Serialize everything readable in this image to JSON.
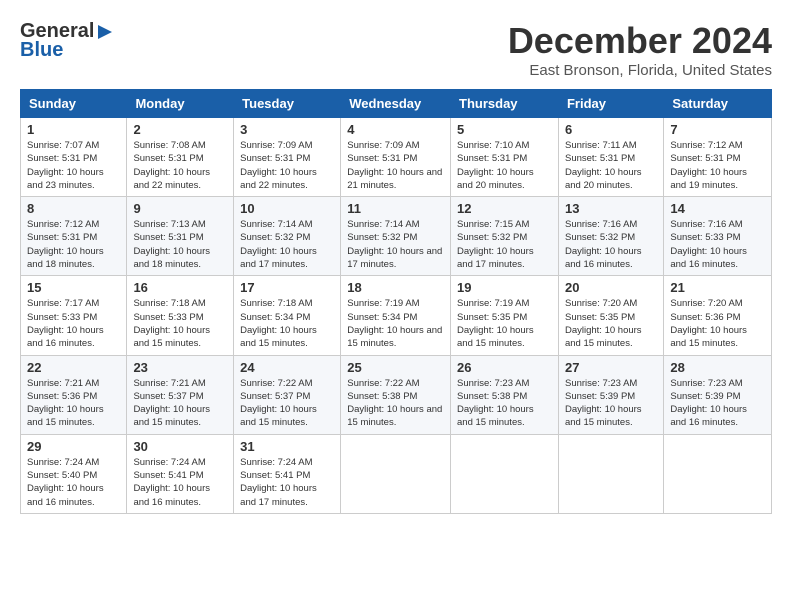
{
  "header": {
    "logo_line1": "General",
    "logo_line2": "Blue",
    "month": "December 2024",
    "location": "East Bronson, Florida, United States"
  },
  "days_of_week": [
    "Sunday",
    "Monday",
    "Tuesday",
    "Wednesday",
    "Thursday",
    "Friday",
    "Saturday"
  ],
  "weeks": [
    [
      {
        "day": "1",
        "sunrise": "7:07 AM",
        "sunset": "5:31 PM",
        "daylight": "10 hours and 23 minutes."
      },
      {
        "day": "2",
        "sunrise": "7:08 AM",
        "sunset": "5:31 PM",
        "daylight": "10 hours and 22 minutes."
      },
      {
        "day": "3",
        "sunrise": "7:09 AM",
        "sunset": "5:31 PM",
        "daylight": "10 hours and 22 minutes."
      },
      {
        "day": "4",
        "sunrise": "7:09 AM",
        "sunset": "5:31 PM",
        "daylight": "10 hours and 21 minutes."
      },
      {
        "day": "5",
        "sunrise": "7:10 AM",
        "sunset": "5:31 PM",
        "daylight": "10 hours and 20 minutes."
      },
      {
        "day": "6",
        "sunrise": "7:11 AM",
        "sunset": "5:31 PM",
        "daylight": "10 hours and 20 minutes."
      },
      {
        "day": "7",
        "sunrise": "7:12 AM",
        "sunset": "5:31 PM",
        "daylight": "10 hours and 19 minutes."
      }
    ],
    [
      {
        "day": "8",
        "sunrise": "7:12 AM",
        "sunset": "5:31 PM",
        "daylight": "10 hours and 18 minutes."
      },
      {
        "day": "9",
        "sunrise": "7:13 AM",
        "sunset": "5:31 PM",
        "daylight": "10 hours and 18 minutes."
      },
      {
        "day": "10",
        "sunrise": "7:14 AM",
        "sunset": "5:32 PM",
        "daylight": "10 hours and 17 minutes."
      },
      {
        "day": "11",
        "sunrise": "7:14 AM",
        "sunset": "5:32 PM",
        "daylight": "10 hours and 17 minutes."
      },
      {
        "day": "12",
        "sunrise": "7:15 AM",
        "sunset": "5:32 PM",
        "daylight": "10 hours and 17 minutes."
      },
      {
        "day": "13",
        "sunrise": "7:16 AM",
        "sunset": "5:32 PM",
        "daylight": "10 hours and 16 minutes."
      },
      {
        "day": "14",
        "sunrise": "7:16 AM",
        "sunset": "5:33 PM",
        "daylight": "10 hours and 16 minutes."
      }
    ],
    [
      {
        "day": "15",
        "sunrise": "7:17 AM",
        "sunset": "5:33 PM",
        "daylight": "10 hours and 16 minutes."
      },
      {
        "day": "16",
        "sunrise": "7:18 AM",
        "sunset": "5:33 PM",
        "daylight": "10 hours and 15 minutes."
      },
      {
        "day": "17",
        "sunrise": "7:18 AM",
        "sunset": "5:34 PM",
        "daylight": "10 hours and 15 minutes."
      },
      {
        "day": "18",
        "sunrise": "7:19 AM",
        "sunset": "5:34 PM",
        "daylight": "10 hours and 15 minutes."
      },
      {
        "day": "19",
        "sunrise": "7:19 AM",
        "sunset": "5:35 PM",
        "daylight": "10 hours and 15 minutes."
      },
      {
        "day": "20",
        "sunrise": "7:20 AM",
        "sunset": "5:35 PM",
        "daylight": "10 hours and 15 minutes."
      },
      {
        "day": "21",
        "sunrise": "7:20 AM",
        "sunset": "5:36 PM",
        "daylight": "10 hours and 15 minutes."
      }
    ],
    [
      {
        "day": "22",
        "sunrise": "7:21 AM",
        "sunset": "5:36 PM",
        "daylight": "10 hours and 15 minutes."
      },
      {
        "day": "23",
        "sunrise": "7:21 AM",
        "sunset": "5:37 PM",
        "daylight": "10 hours and 15 minutes."
      },
      {
        "day": "24",
        "sunrise": "7:22 AM",
        "sunset": "5:37 PM",
        "daylight": "10 hours and 15 minutes."
      },
      {
        "day": "25",
        "sunrise": "7:22 AM",
        "sunset": "5:38 PM",
        "daylight": "10 hours and 15 minutes."
      },
      {
        "day": "26",
        "sunrise": "7:23 AM",
        "sunset": "5:38 PM",
        "daylight": "10 hours and 15 minutes."
      },
      {
        "day": "27",
        "sunrise": "7:23 AM",
        "sunset": "5:39 PM",
        "daylight": "10 hours and 15 minutes."
      },
      {
        "day": "28",
        "sunrise": "7:23 AM",
        "sunset": "5:39 PM",
        "daylight": "10 hours and 16 minutes."
      }
    ],
    [
      {
        "day": "29",
        "sunrise": "7:24 AM",
        "sunset": "5:40 PM",
        "daylight": "10 hours and 16 minutes."
      },
      {
        "day": "30",
        "sunrise": "7:24 AM",
        "sunset": "5:41 PM",
        "daylight": "10 hours and 16 minutes."
      },
      {
        "day": "31",
        "sunrise": "7:24 AM",
        "sunset": "5:41 PM",
        "daylight": "10 hours and 17 minutes."
      },
      null,
      null,
      null,
      null
    ]
  ]
}
